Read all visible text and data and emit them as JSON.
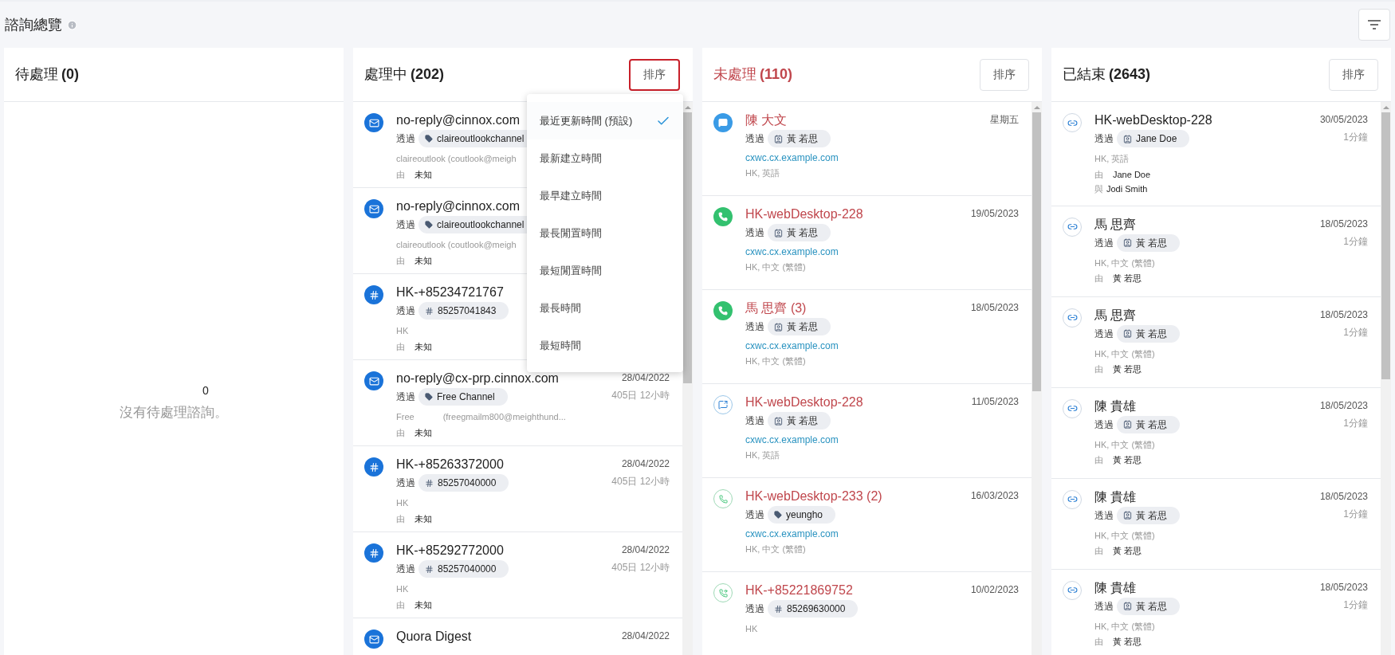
{
  "page": {
    "title": "諮詢總覽"
  },
  "columns": [
    {
      "kind": "pending",
      "title": "待處理",
      "count": "(0)",
      "empty": {
        "count": "0",
        "message": "沒有待處理諮詢。"
      }
    },
    {
      "kind": "active",
      "title": "處理中",
      "count": "(202)",
      "sort_button": {
        "label": "排序",
        "highlighted": true
      },
      "sort_menu": [
        {
          "label": "最近更新時間 (預設)",
          "selected": true
        },
        {
          "label": "最新建立時間",
          "selected": false
        },
        {
          "label": "最早建立時間",
          "selected": false
        },
        {
          "label": "最長閒置時間",
          "selected": false
        },
        {
          "label": "最短閒置時間",
          "selected": false
        },
        {
          "label": "最長時間",
          "selected": false
        },
        {
          "label": "最短時間",
          "selected": false
        }
      ],
      "cards": [
        {
          "kind": "email",
          "title": "no-reply@cinnox.com",
          "via_label": "透過",
          "chip": {
            "kind": "tag",
            "text": "claireoutlookchannel"
          },
          "detail": [
            "claireoutlook (coutlook@meigh"
          ],
          "from_label": "由",
          "from": "未知"
        },
        {
          "kind": "email",
          "title": "no-reply@cinnox.com",
          "via_label": "透過",
          "chip": {
            "kind": "tag",
            "text": "claireoutlookchannel"
          },
          "detail": [
            "claireoutlook (coutlook@meigh"
          ],
          "from_label": "由",
          "from": "未知"
        },
        {
          "kind": "hash",
          "title": "HK-+85234721767",
          "via_label": "透過",
          "chip": {
            "kind": "hash",
            "text": "85257041843"
          },
          "detail": [
            "HK"
          ],
          "from_label": "由",
          "from": "未知"
        },
        {
          "kind": "email",
          "title": "no-reply@cx-prp.cinnox.com",
          "date": "28/04/2022",
          "duration": "405日 12小時",
          "via_label": "透過",
          "chip": {
            "kind": "tag",
            "text": "Free Channel"
          },
          "detail": [
            "Free",
            "(freegmailm800@meighthund..."
          ],
          "from_label": "由",
          "from": "未知"
        },
        {
          "kind": "hash",
          "title": "HK-+85263372000",
          "date": "28/04/2022",
          "duration": "405日 12小時",
          "via_label": "透過",
          "chip": {
            "kind": "hash",
            "text": "85257040000"
          },
          "detail": [
            "HK"
          ],
          "from_label": "由",
          "from": "未知"
        },
        {
          "kind": "hash",
          "title": "HK-+85292772000",
          "date": "28/04/2022",
          "duration": "405日 12小時",
          "via_label": "透過",
          "chip": {
            "kind": "hash",
            "text": "85257040000"
          },
          "detail": [
            "HK"
          ],
          "from_label": "由",
          "from": "未知"
        },
        {
          "kind": "email",
          "title": "Quora Digest",
          "date": "28/04/2022"
        }
      ]
    },
    {
      "kind": "unhandled",
      "title": "未處理",
      "count": "(110)",
      "sort_button": {
        "label": "排序",
        "highlighted": false
      },
      "cards": [
        {
          "kind": "chat",
          "title": "陳 大文",
          "date": "星期五",
          "via_label": "透過",
          "chip": {
            "kind": "contact",
            "text": "黃 若思"
          },
          "link": "cxwc.cx.example.com",
          "detail": [
            "HK, 英語"
          ]
        },
        {
          "kind": "phone",
          "title": "HK-webDesktop-228",
          "date": "19/05/2023",
          "via_label": "透過",
          "chip": {
            "kind": "contact",
            "text": "黃 若思"
          },
          "link": "cxwc.cx.example.com",
          "detail": [
            "HK, 中文 (繁體)"
          ]
        },
        {
          "kind": "phone",
          "title": "馬 思齊 (3)",
          "date": "18/05/2023",
          "via_label": "透過",
          "chip": {
            "kind": "contact",
            "text": "黃 若思"
          },
          "link": "cxwc.cx.example.com",
          "detail": [
            "HK, 中文 (繁體)"
          ]
        },
        {
          "kind": "video",
          "title": "HK-webDesktop-228",
          "date": "11/05/2023",
          "via_label": "透過",
          "chip": {
            "kind": "contact",
            "text": "黃 若思"
          },
          "link": "cxwc.cx.example.com",
          "detail": [
            "HK, 英語"
          ]
        },
        {
          "kind": "phone-outline",
          "title": "HK-webDesktop-233 (2)",
          "date": "16/03/2023",
          "via_label": "透過",
          "chip": {
            "kind": "tag",
            "text": "yeungho"
          },
          "link": "cxwc.cx.example.com",
          "detail": [
            "HK, 中文 (繁體)"
          ]
        },
        {
          "kind": "phone-transfer",
          "title": "HK-+85221869752",
          "date": "10/02/2023",
          "via_label": "透過",
          "chip": {
            "kind": "hash",
            "text": "85269630000"
          },
          "detail": [
            "HK"
          ]
        }
      ]
    },
    {
      "kind": "closed",
      "title": "已結束",
      "count": "(2643)",
      "sort_button": {
        "label": "排序",
        "highlighted": false
      },
      "cards": [
        {
          "kind": "link",
          "title": "HK-webDesktop-228",
          "date": "30/05/2023",
          "duration": "1分鐘",
          "via_label": "透過",
          "chip": {
            "kind": "contact",
            "text": "Jane Doe"
          },
          "detail": [
            "HK, 英語"
          ],
          "from_label": "由",
          "from": "Jane Doe",
          "with_label": "與",
          "with": "Jodi Smith"
        },
        {
          "kind": "link",
          "title": "馬 思齊",
          "date": "18/05/2023",
          "duration": "1分鐘",
          "via_label": "透過",
          "chip": {
            "kind": "contact",
            "text": "黃 若思"
          },
          "detail": [
            "HK, 中文 (繁體)"
          ],
          "from_label": "由",
          "from": "黃 若思"
        },
        {
          "kind": "link",
          "title": "馬 思齊",
          "date": "18/05/2023",
          "duration": "1分鐘",
          "via_label": "透過",
          "chip": {
            "kind": "contact",
            "text": "黃 若思"
          },
          "detail": [
            "HK, 中文 (繁體)"
          ],
          "from_label": "由",
          "from": "黃 若思"
        },
        {
          "kind": "link",
          "title": "陳 貴雄",
          "date": "18/05/2023",
          "duration": "1分鐘",
          "via_label": "透過",
          "chip": {
            "kind": "contact",
            "text": "黃 若思"
          },
          "detail": [
            "HK, 中文 (繁體)"
          ],
          "from_label": "由",
          "from": "黃 若思"
        },
        {
          "kind": "link",
          "title": "陳 貴雄",
          "date": "18/05/2023",
          "duration": "1分鐘",
          "via_label": "透過",
          "chip": {
            "kind": "contact",
            "text": "黃 若思"
          },
          "detail": [
            "HK, 中文 (繁體)"
          ],
          "from_label": "由",
          "from": "黃 若思"
        },
        {
          "kind": "link",
          "title": "陳 貴雄",
          "date": "18/05/2023",
          "duration": "1分鐘",
          "via_label": "透過",
          "chip": {
            "kind": "contact",
            "text": "黃 若思"
          },
          "detail": [
            "HK, 中文 (繁體)"
          ],
          "from_label": "由",
          "from": "黃 若思"
        }
      ]
    }
  ]
}
